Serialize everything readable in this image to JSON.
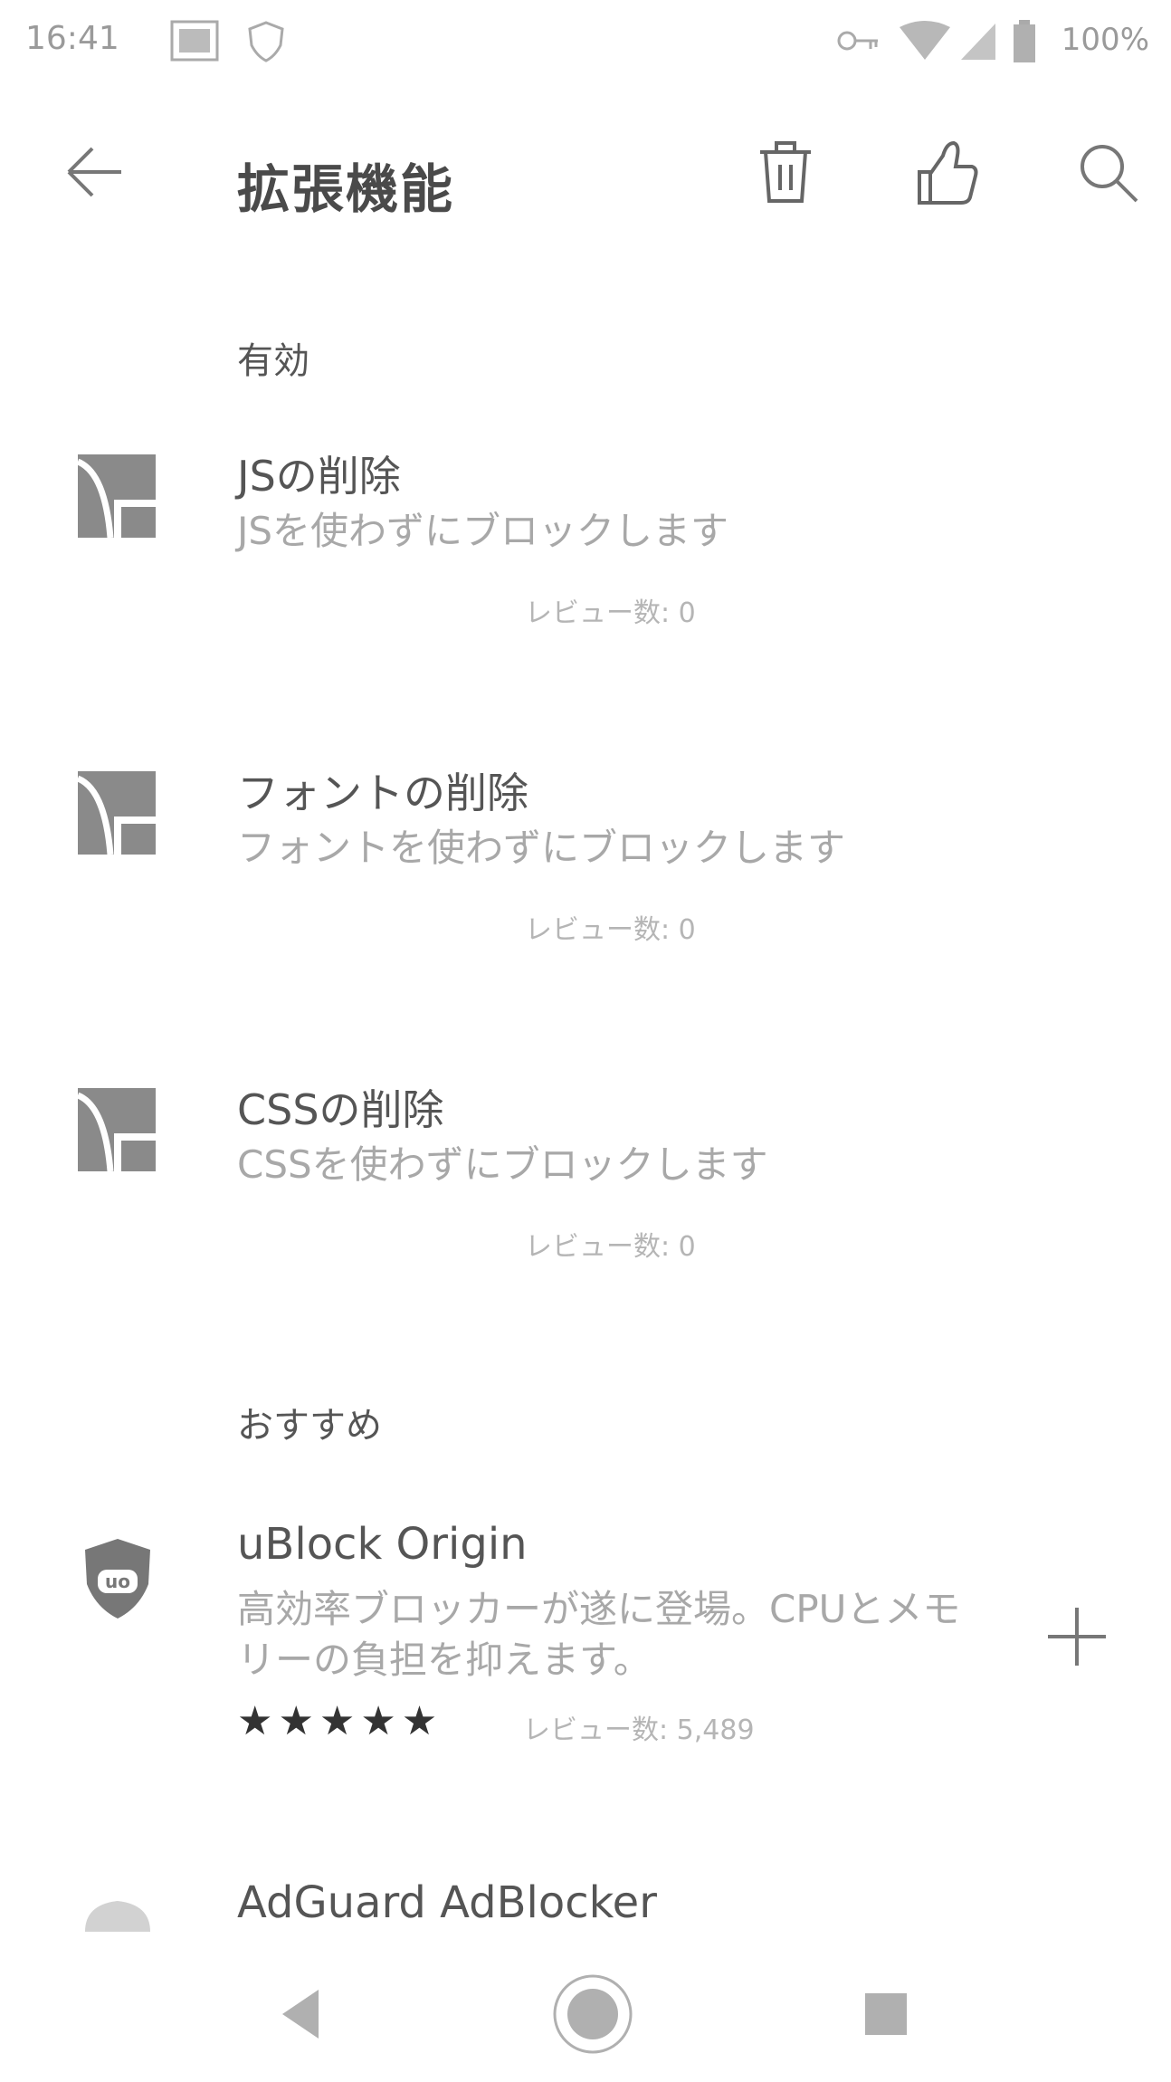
{
  "status_bar": {
    "time": "16:41",
    "battery": "100%"
  },
  "app_bar": {
    "title": "拡張機能"
  },
  "sections": {
    "enabled": {
      "header": "有効",
      "items": [
        {
          "title": "JSの削除",
          "description": "JSを使わずにブロックします",
          "reviews": "レビュー数: 0"
        },
        {
          "title": "フォントの削除",
          "description": "フォントを使わずにブロックします",
          "reviews": "レビュー数: 0"
        },
        {
          "title": "CSSの削除",
          "description": "CSSを使わずにブロックします",
          "reviews": "レビュー数: 0"
        }
      ]
    },
    "recommended": {
      "header": "おすすめ",
      "items": [
        {
          "title": "uBlock Origin",
          "description": "高効率ブロッカーが遂に登場。CPUとメモリーの負担を抑えます。",
          "stars": "★★★★★",
          "rating": 5,
          "reviews": "レビュー数: 5,489"
        },
        {
          "title": "AdGuard AdBlocker"
        }
      ]
    }
  },
  "icons": {
    "back": "arrow-left-icon",
    "trash": "trash-icon",
    "thumbs_up": "thumbs-up-icon",
    "search": "search-icon",
    "add": "plus-icon"
  },
  "colors": {
    "text_primary": "#555555",
    "text_secondary": "#a8a8a8",
    "icon": "#7a7a7a"
  }
}
